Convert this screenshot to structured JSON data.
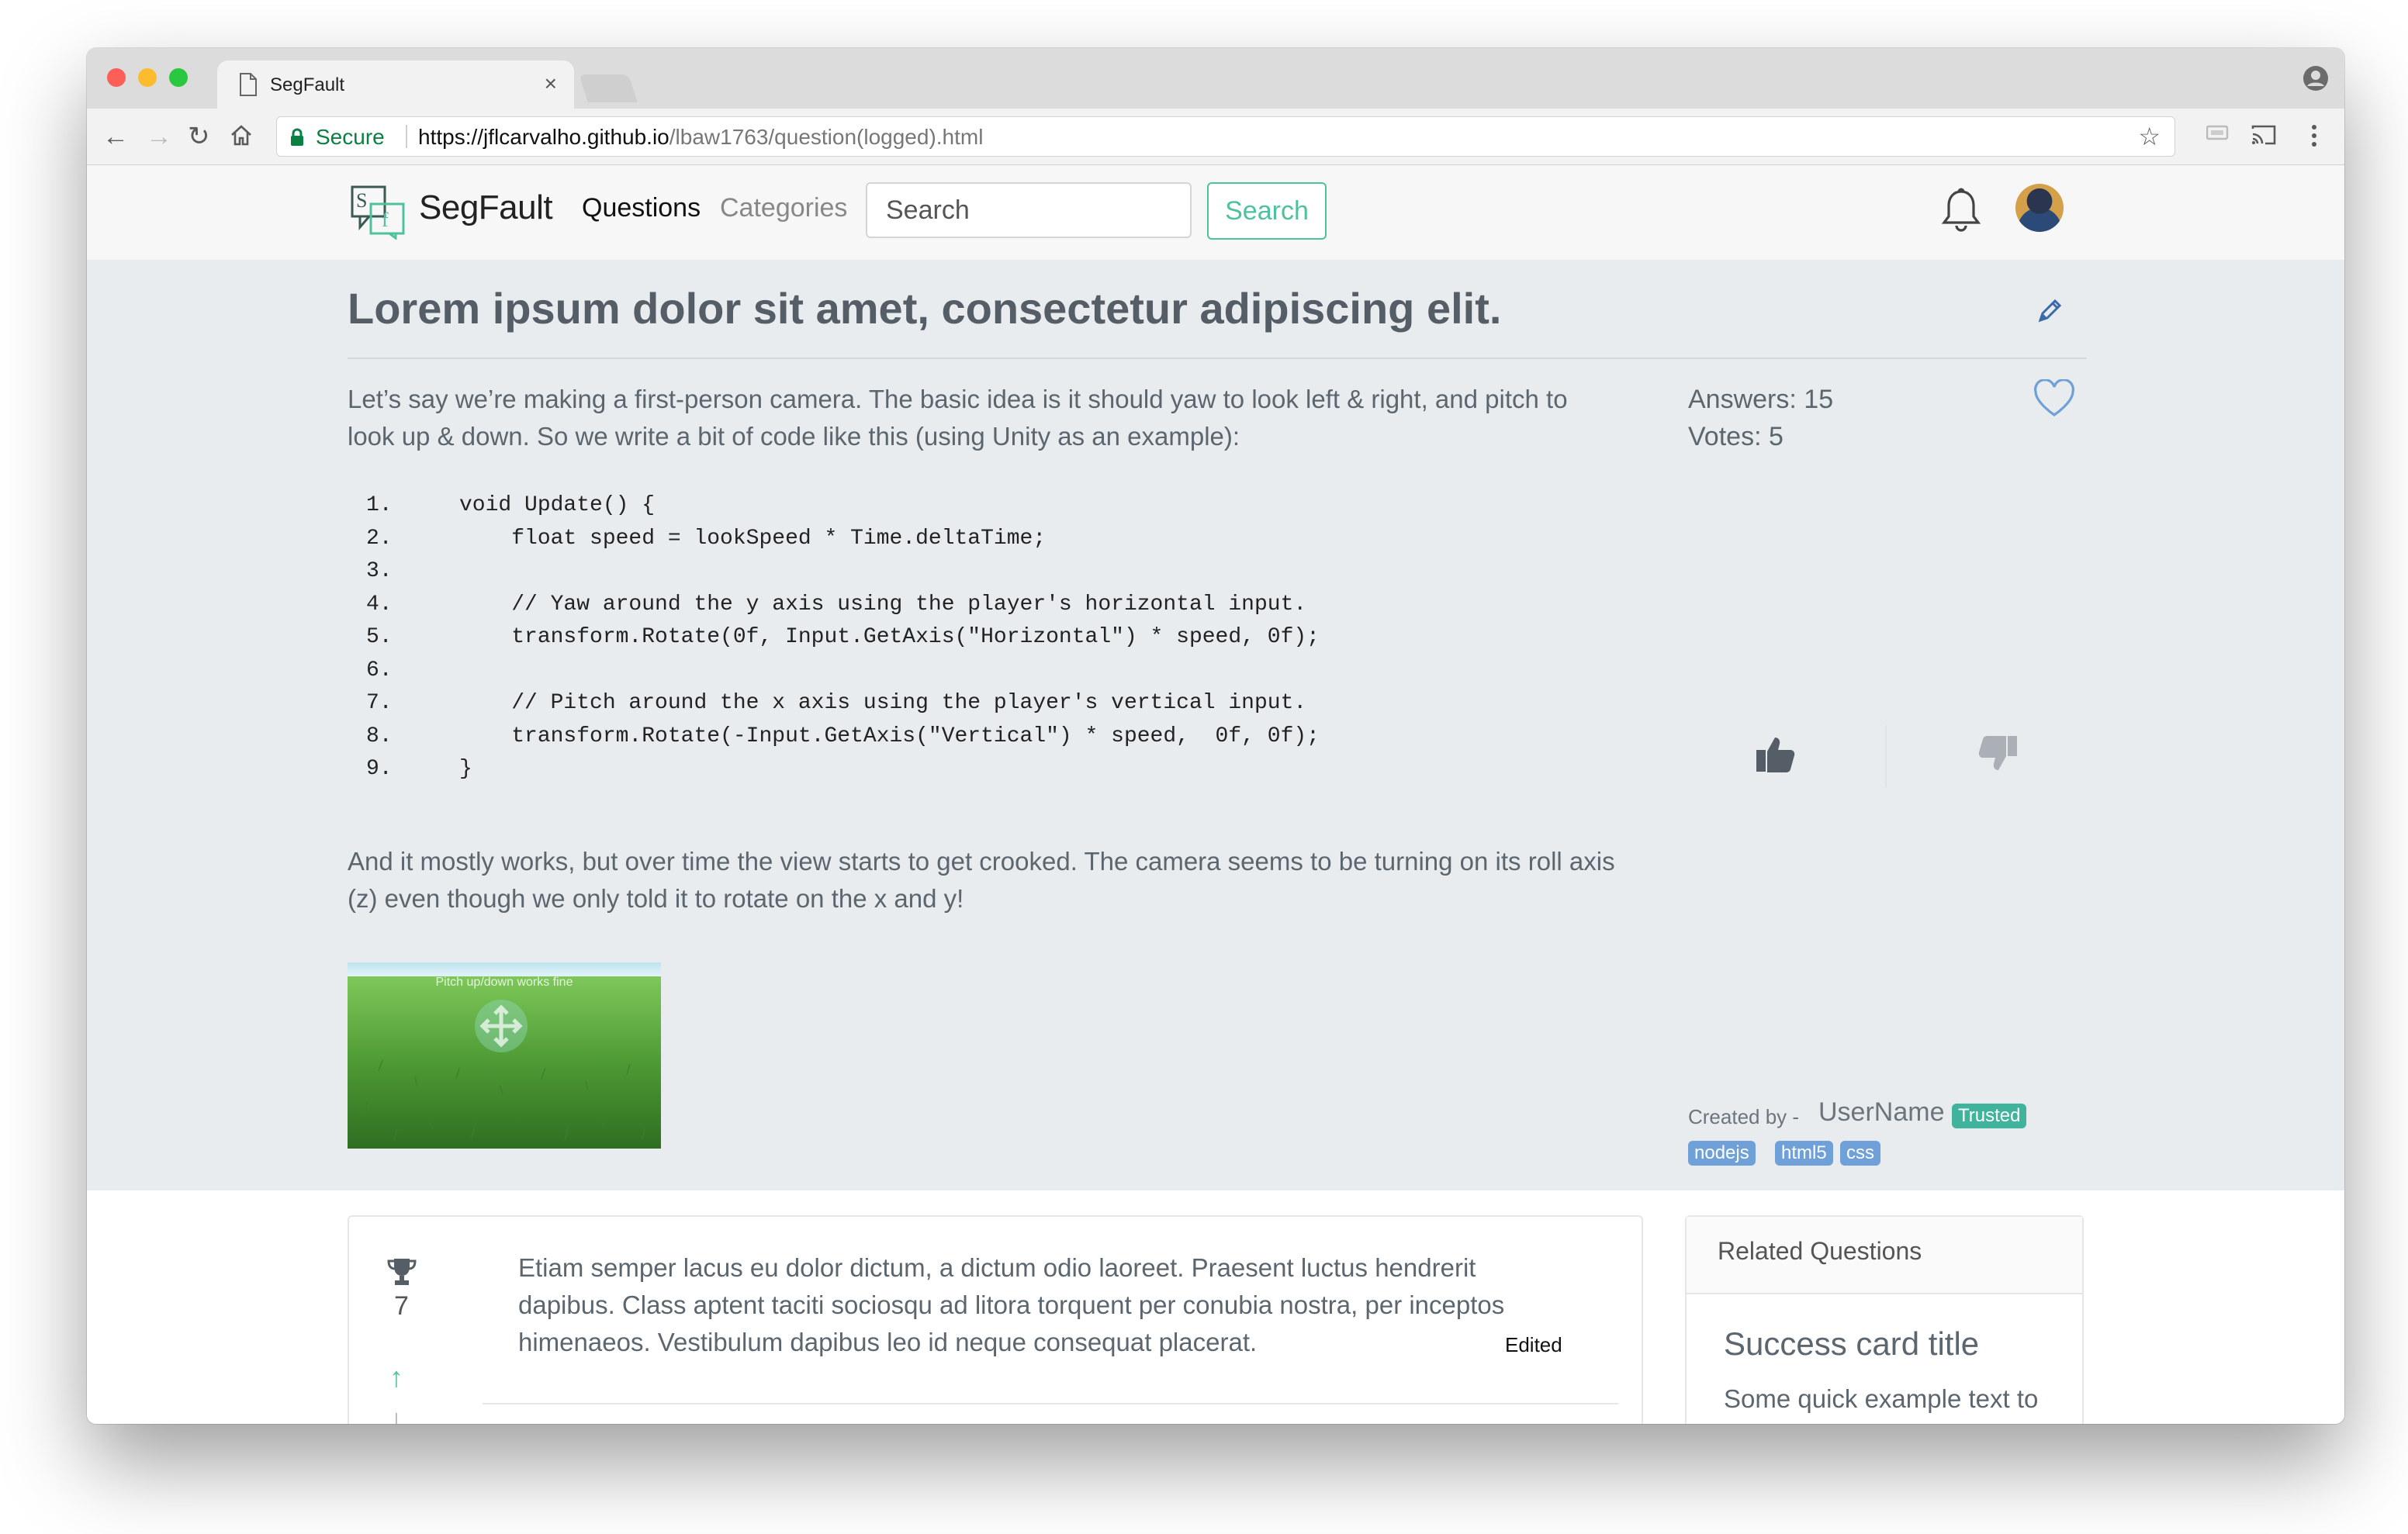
{
  "browser": {
    "tab_title": "SegFault",
    "secure_label": "Secure",
    "url_host": "https://jflcarvalho.github.io",
    "url_path": "/lbaw1763/question(logged).html"
  },
  "navbar": {
    "brand": "SegFault",
    "logo_letters": "Sf",
    "links": {
      "questions": "Questions",
      "categories": "Categories"
    },
    "search": {
      "placeholder": "Search",
      "button_label": "Search"
    }
  },
  "question": {
    "title": "Lorem ipsum dolor sit amet, consectetur adipiscing elit.",
    "intro": "Let’s say we’re making a first-person camera. The basic idea is it should yaw to look left & right, and pitch to look up & down. So we write a bit of code like this (using Unity as an example):",
    "code_lines": [
      {
        "num": "1.",
        "text": "void Update() {"
      },
      {
        "num": "2.",
        "text": "    float speed = lookSpeed * Time.deltaTime;"
      },
      {
        "num": "3.",
        "text": ""
      },
      {
        "num": "4.",
        "text": "    // Yaw around the y axis using the player's horizontal input."
      },
      {
        "num": "5.",
        "text": "    transform.Rotate(0f, Input.GetAxis(\"Horizontal\") * speed, 0f);"
      },
      {
        "num": "6.",
        "text": ""
      },
      {
        "num": "7.",
        "text": "    // Pitch around the x axis using the player's vertical input."
      },
      {
        "num": "8.",
        "text": "    transform.Rotate(-Input.GetAxis(\"Vertical\") * speed,  0f, 0f);"
      },
      {
        "num": "9.",
        "text": "}"
      }
    ],
    "outro": "And it mostly works, but over time the view starts to get crooked. The camera seems to be turning on its roll axis (z) even though we only told it to rotate on the x and y!",
    "image_caption": "Pitch up/down works fine",
    "answers_label": "Answers:",
    "answers_count": "15",
    "votes_label": "Votes:",
    "votes_count": "5",
    "created_by_label": "Created by -",
    "username": "UserName",
    "user_badge": "Trusted",
    "tags": [
      "nodejs",
      "html5",
      "css"
    ]
  },
  "answer": {
    "score": "7",
    "text": "Etiam semper lacus eu dolor dictum, a dictum odio laoreet. Praesent luctus hendrerit dapibus. Class aptent taciti sociosqu ad litora torquent per conubia nostra, per inceptos himenaeos. Vestibulum dapibus leo id neque consequat placerat.",
    "edited_label": "Edited"
  },
  "related": {
    "header": "Related Questions",
    "card_title": "Success card title",
    "card_text": "Some quick example text to"
  },
  "colors": {
    "accent": "#4fc29d",
    "trusted_badge": "#3fb39c",
    "tag_badge": "#6fa0d8",
    "hero_bg": "#e9ecef"
  }
}
